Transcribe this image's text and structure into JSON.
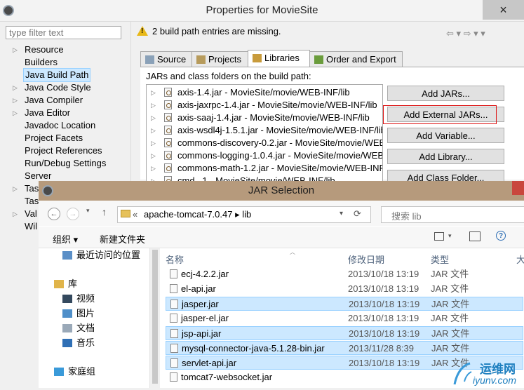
{
  "props": {
    "title": "Properties for MovieSite",
    "close": "×",
    "filter_placeholder": "type filter text",
    "tree": [
      {
        "label": "Resource",
        "arrow": "▷",
        "selected": false
      },
      {
        "label": "Builders",
        "arrow": "",
        "selected": false
      },
      {
        "label": "Java Build Path",
        "arrow": "",
        "selected": true
      },
      {
        "label": "Java Code Style",
        "arrow": "▷",
        "selected": false
      },
      {
        "label": "Java Compiler",
        "arrow": "▷",
        "selected": false
      },
      {
        "label": "Java Editor",
        "arrow": "▷",
        "selected": false
      },
      {
        "label": "Javadoc Location",
        "arrow": "",
        "selected": false
      },
      {
        "label": "Project Facets",
        "arrow": "",
        "selected": false
      },
      {
        "label": "Project References",
        "arrow": "",
        "selected": false
      },
      {
        "label": "Run/Debug Settings",
        "arrow": "",
        "selected": false
      },
      {
        "label": "Server",
        "arrow": "",
        "selected": false
      },
      {
        "label": "Tas",
        "arrow": "▷",
        "selected": false
      },
      {
        "label": "Tas",
        "arrow": "",
        "selected": false
      },
      {
        "label": "Val",
        "arrow": "▷",
        "selected": false
      },
      {
        "label": "Wil",
        "arrow": "",
        "selected": false
      }
    ],
    "warning": "2 build path entries are missing.",
    "nav_arrows": "⇦ ▾ ⇨ ▾ ▾",
    "tabs": [
      {
        "label": "Source",
        "active": false
      },
      {
        "label": "Projects",
        "active": false
      },
      {
        "label": "Libraries",
        "active": true
      },
      {
        "label": "Order and Export",
        "active": false
      }
    ],
    "panel_label": "JARs and class folders on the build path:",
    "jars": [
      "axis-1.4.jar - MovieSite/movie/WEB-INF/lib",
      "axis-jaxrpc-1.4.jar - MovieSite/movie/WEB-INF/lib",
      "axis-saaj-1.4.jar - MovieSite/movie/WEB-INF/lib",
      "axis-wsdl4j-1.5.1.jar - MovieSite/movie/WEB-INF/lib",
      "commons-discovery-0.2.jar - MovieSite/movie/WEB-INF/lib",
      "commons-logging-1.0.4.jar - MovieSite/movie/WEB-INF/lib",
      "commons-math-1.2.jar - MovieSite/movie/WEB-INF/lib",
      "cmd_.1 - MovieSite/movie/WEB-INF/lib"
    ],
    "buttons": [
      "Add JARs...",
      "Add External JARs...",
      "Add Variable...",
      "Add Library...",
      "Add Class Folder..."
    ]
  },
  "dialog": {
    "title": "JAR Selection",
    "back": "←",
    "forward": "→",
    "up": "↑",
    "addr_prefix": "«",
    "addr_path": "apache-tomcat-7.0.47 ▸ lib",
    "addr_dropdown": "▾",
    "refresh": "⟳",
    "search_placeholder": "搜索 lib",
    "toolbar": {
      "organize": "组织 ▾",
      "new_folder": "新建文件夹"
    },
    "nav": [
      {
        "label": "最近访问的位置",
        "indent": 1,
        "icon": "recent-icon"
      },
      {
        "label": "库",
        "indent": 0,
        "icon": "library-icon"
      },
      {
        "label": "视频",
        "indent": 1,
        "icon": "video-icon"
      },
      {
        "label": "图片",
        "indent": 1,
        "icon": "picture-icon"
      },
      {
        "label": "文档",
        "indent": 1,
        "icon": "document-icon"
      },
      {
        "label": "音乐",
        "indent": 1,
        "icon": "music-icon"
      },
      {
        "label": "家庭组",
        "indent": 0,
        "icon": "homegroup-icon"
      }
    ],
    "columns": {
      "name": "名称",
      "date": "修改日期",
      "type": "类型",
      "size": "大"
    },
    "files": [
      {
        "name": "ecj-4.2.2.jar",
        "date": "2013/10/18 13:19",
        "type": "JAR 文件",
        "selected": false
      },
      {
        "name": "el-api.jar",
        "date": "2013/10/18 13:19",
        "type": "JAR 文件",
        "selected": false
      },
      {
        "name": "jasper.jar",
        "date": "2013/10/18 13:19",
        "type": "JAR 文件",
        "selected": true
      },
      {
        "name": "jasper-el.jar",
        "date": "2013/10/18 13:19",
        "type": "JAR 文件",
        "selected": false
      },
      {
        "name": "jsp-api.jar",
        "date": "2013/10/18 13:19",
        "type": "JAR 文件",
        "selected": true
      },
      {
        "name": "mysql-connector-java-5.1.28-bin.jar",
        "date": "2013/11/28 8:39",
        "type": "JAR 文件",
        "selected": true
      },
      {
        "name": "servlet-api.jar",
        "date": "2013/10/18 13:19",
        "type": "JAR 文件",
        "selected": true
      },
      {
        "name": "tomcat7-websocket.jar",
        "date": "",
        "type": "",
        "selected": false
      }
    ]
  },
  "watermark": {
    "text": "运维网",
    "url": "iyunv.com"
  }
}
